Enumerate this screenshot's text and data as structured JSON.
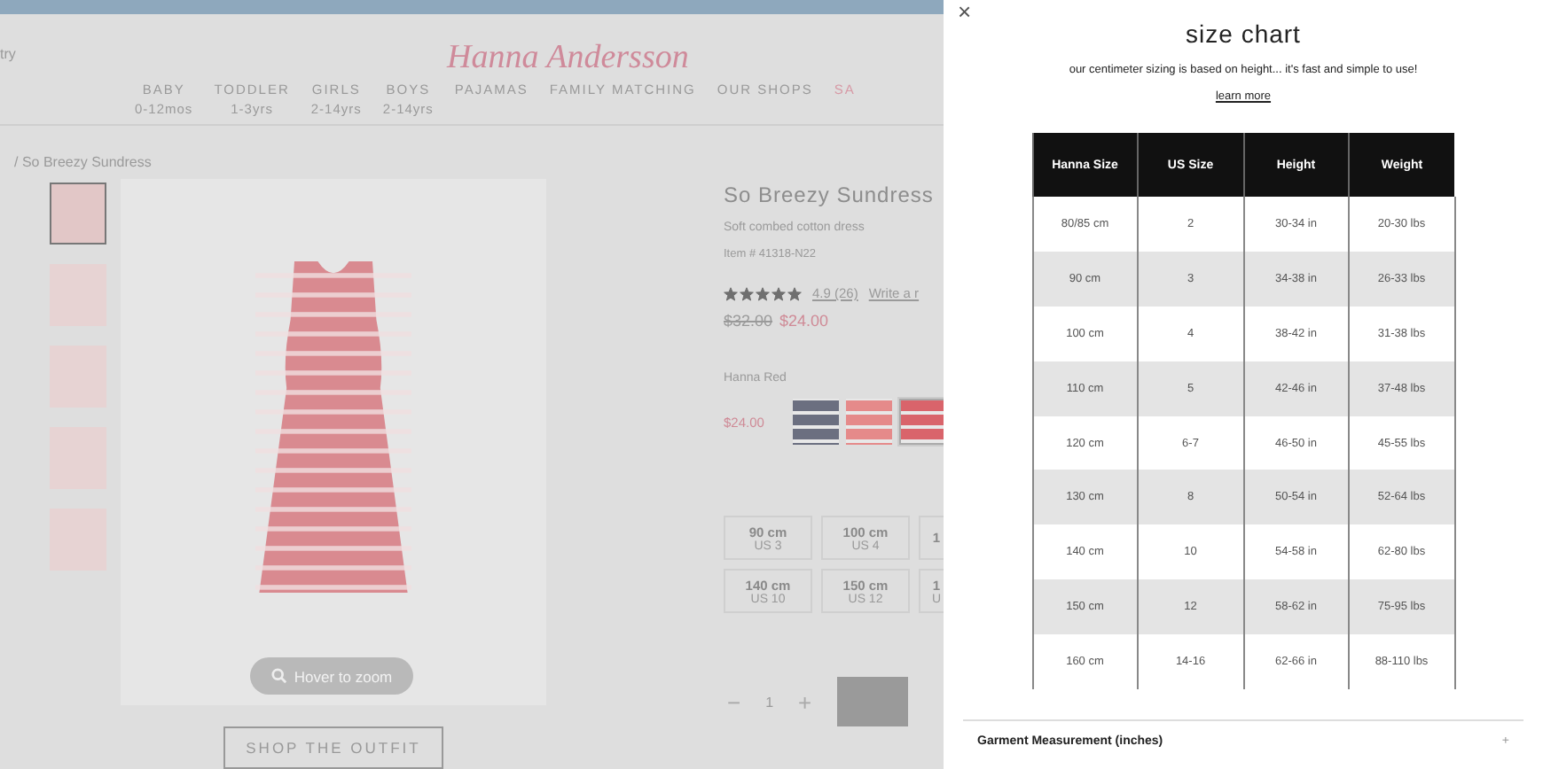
{
  "header": {
    "utility_text": "try",
    "logo": "Hanna Andersson",
    "nav": [
      {
        "label": "BABY",
        "sub": "0-12mos",
        "highlighted": false
      },
      {
        "label": "TODDLER",
        "sub": "1-3yrs",
        "highlighted": false
      },
      {
        "label": "GIRLS",
        "sub": "2-14yrs",
        "highlighted": false
      },
      {
        "label": "BOYS",
        "sub": "2-14yrs",
        "highlighted": false
      },
      {
        "label": "PAJAMAS",
        "highlighted": false
      },
      {
        "label": "FAMILY MATCHING",
        "highlighted": false
      },
      {
        "label": "OUR SHOPS",
        "highlighted": false
      },
      {
        "label": "SA",
        "highlighted": true
      }
    ]
  },
  "breadcrumb": "/ So Breezy Sundress",
  "gallery": {
    "thumbnails": [
      {
        "selected": true
      },
      {
        "selected": false
      },
      {
        "selected": false
      },
      {
        "selected": false
      },
      {
        "selected": false
      }
    ],
    "zoom_hint": "Hover to zoom",
    "shop_button": "SHOP THE OUTFIT"
  },
  "product": {
    "title": "So Breezy Sundress",
    "subtitle": "Soft combed cotton dress",
    "item_number": "Item # 41318-N22",
    "stars": 5,
    "rating": "4.9 (26)",
    "write_review": "Write a r",
    "old_price": "$32.00",
    "price": "$24.00",
    "color_name": "Hanna Red",
    "swatch_price": "$24.00",
    "swatches": [
      {
        "color": "#6b6f80",
        "selected": false
      },
      {
        "color": "#e58a8a",
        "selected": false
      },
      {
        "color": "#d9646b",
        "selected": true
      }
    ],
    "sizes": [
      {
        "size": "90 cm",
        "us": "US 3"
      },
      {
        "size": "100 cm",
        "us": "US 4"
      },
      {
        "size": "1"
      },
      {
        "size": "140 cm",
        "us": "US 10"
      },
      {
        "size": "150 cm",
        "us": "US 12"
      },
      {
        "size": "1",
        "us": "U"
      }
    ],
    "quantity": {
      "minus": "−",
      "value": "1",
      "plus": "+"
    }
  },
  "size_chart": {
    "close": "×",
    "title": "size chart",
    "intro": "our centimeter sizing is based on height... it's fast and simple to use!",
    "link": "learn more",
    "columns": [
      "Hanna Size",
      "US Size",
      "Height",
      "Weight"
    ],
    "rows": [
      [
        "80/85 cm",
        "2",
        "30-34 in",
        "20-30 lbs"
      ],
      [
        "90 cm",
        "3",
        "34-38 in",
        "26-33 lbs"
      ],
      [
        "100 cm",
        "4",
        "38-42 in",
        "31-38 lbs"
      ],
      [
        "110 cm",
        "5",
        "42-46 in",
        "37-48 lbs"
      ],
      [
        "120 cm",
        "6-7",
        "46-50 in",
        "45-55 lbs"
      ],
      [
        "130 cm",
        "8",
        "50-54 in",
        "52-64 lbs"
      ],
      [
        "140 cm",
        "10",
        "54-58 in",
        "62-80 lbs"
      ],
      [
        "150 cm",
        "12",
        "58-62 in",
        "75-95 lbs"
      ],
      [
        "160 cm",
        "14-16",
        "62-66 in",
        "88-110 lbs"
      ]
    ],
    "accordion": {
      "label": "Garment Measurement (inches)",
      "expanded": false,
      "toggle": "+"
    }
  }
}
